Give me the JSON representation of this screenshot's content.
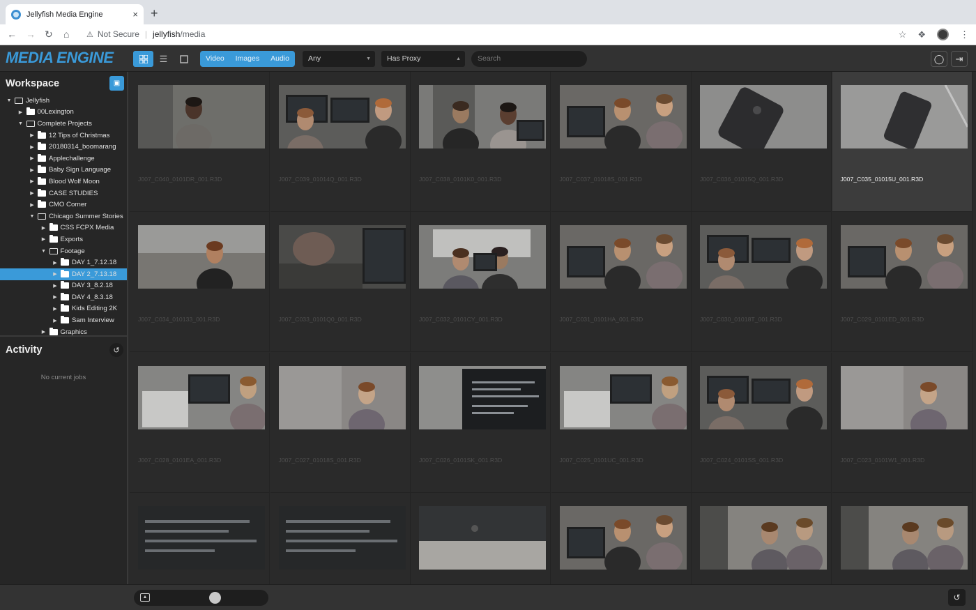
{
  "browser": {
    "tab_title": "Jellyfish Media Engine",
    "tab_close": "×",
    "new_tab": "+",
    "security_label": "Not Secure",
    "url_host": "jellyfish",
    "url_path": "/media"
  },
  "app": {
    "logo": "MEDIA ENGINE",
    "view_mode_active": "grid",
    "media_types": [
      "Video",
      "Images",
      "Audio"
    ],
    "filter_any": "Any",
    "filter_proxy": "Has Proxy",
    "search_placeholder": "Search"
  },
  "sidebar": {
    "workspace_title": "Workspace",
    "tree": [
      {
        "label": "Jellyfish",
        "depth": 0,
        "expanded": true,
        "open_folder": true
      },
      {
        "label": "00Lexington",
        "depth": 1,
        "expanded": false
      },
      {
        "label": "Complete Projects",
        "depth": 1,
        "expanded": true,
        "open_folder": true
      },
      {
        "label": "12 Tips of Christmas",
        "depth": 2,
        "expanded": false
      },
      {
        "label": "20180314_boomarang",
        "depth": 2,
        "expanded": false
      },
      {
        "label": "Applechallenge",
        "depth": 2,
        "expanded": false
      },
      {
        "label": "Baby Sign Language",
        "depth": 2,
        "expanded": false
      },
      {
        "label": "Blood Wolf Moon",
        "depth": 2,
        "expanded": false
      },
      {
        "label": "CASE STUDIES",
        "depth": 2,
        "expanded": false
      },
      {
        "label": "CMO Corner",
        "depth": 2,
        "expanded": false
      },
      {
        "label": "Chicago Summer Stories",
        "depth": 2,
        "expanded": true,
        "open_folder": true
      },
      {
        "label": "CSS FCPX Media",
        "depth": 3,
        "expanded": false
      },
      {
        "label": "Exports",
        "depth": 3,
        "expanded": false
      },
      {
        "label": "Footage",
        "depth": 3,
        "expanded": true,
        "open_folder": true
      },
      {
        "label": "DAY 1_7.12.18",
        "depth": 4,
        "expanded": false
      },
      {
        "label": "DAY 2_7.13.18",
        "depth": 4,
        "expanded": false,
        "selected": true
      },
      {
        "label": "DAY 3_8.2.18",
        "depth": 4,
        "expanded": false
      },
      {
        "label": "DAY 4_8.3.18",
        "depth": 4,
        "expanded": false
      },
      {
        "label": "Kids Editing 2K",
        "depth": 4,
        "expanded": false
      },
      {
        "label": "Sam Interview",
        "depth": 4,
        "expanded": false
      },
      {
        "label": "Graphics",
        "depth": 3,
        "expanded": false
      }
    ],
    "activity_title": "Activity",
    "no_jobs": "No current jobs"
  },
  "media": [
    {
      "name": "J007_C040_0101DR_001.R3D",
      "scene": "woman"
    },
    {
      "name": "J007_C039_01014Q_001.R3D",
      "scene": "monitors"
    },
    {
      "name": "J007_C038_0101K0_001.R3D",
      "scene": "office"
    },
    {
      "name": "J007_C037_01018S_001.R3D",
      "scene": "twoguys"
    },
    {
      "name": "J007_C036_01015Q_001.R3D",
      "scene": "phone"
    },
    {
      "name": "J007_C035_01015U_001.R3D",
      "scene": "phone2",
      "selected": true
    },
    {
      "name": "J007_C034_010133_001.R3D",
      "scene": "man"
    },
    {
      "name": "J007_C033_0101Q0_001.R3D",
      "scene": "desk"
    },
    {
      "name": "J007_C032_0101CY_001.R3D",
      "scene": "window"
    },
    {
      "name": "J007_C031_0101HA_001.R3D",
      "scene": "twoguys"
    },
    {
      "name": "J007_C030_01018T_001.R3D",
      "scene": "monitors"
    },
    {
      "name": "J007_C029_0101ED_001.R3D",
      "scene": "twoguys"
    },
    {
      "name": "J007_C028_0101EA_001.R3D",
      "scene": "gear"
    },
    {
      "name": "J007_C027_01018S_001.R3D",
      "scene": "face"
    },
    {
      "name": "J007_C026_0101SK_001.R3D",
      "scene": "screen"
    },
    {
      "name": "J007_C025_0101UC_001.R3D",
      "scene": "gear"
    },
    {
      "name": "J007_C024_0101SS_001.R3D",
      "scene": "monitors"
    },
    {
      "name": "J007_C023_0101W1_001.R3D",
      "scene": "face"
    },
    {
      "name": "",
      "scene": "editor"
    },
    {
      "name": "",
      "scene": "editor"
    },
    {
      "name": "",
      "scene": "imac"
    },
    {
      "name": "",
      "scene": "twoguys"
    },
    {
      "name": "",
      "scene": "blur"
    },
    {
      "name": "",
      "scene": "blur"
    }
  ],
  "footer": {
    "zoom_level": 0.55
  }
}
